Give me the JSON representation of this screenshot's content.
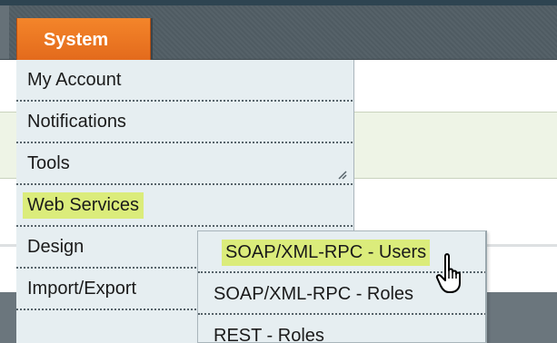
{
  "nav": {
    "active_tab": "System"
  },
  "menu": {
    "items": [
      {
        "label": "My Account"
      },
      {
        "label": "Notifications"
      },
      {
        "label": "Tools"
      },
      {
        "label": "Web Services"
      },
      {
        "label": "Design"
      },
      {
        "label": "Import/Export"
      }
    ]
  },
  "submenu": {
    "items": [
      {
        "label": "SOAP/XML-RPC - Users"
      },
      {
        "label": "SOAP/XML-RPC - Roles"
      },
      {
        "label": "REST - Roles"
      }
    ]
  },
  "colors": {
    "tab_active": "#e8701f",
    "menu_bg": "#e6eef1",
    "highlight": "#dbec7b",
    "nav_bg": "#566269"
  },
  "icons": {
    "cursor": "hand-pointer-icon",
    "resize": "resize-grip-icon"
  }
}
